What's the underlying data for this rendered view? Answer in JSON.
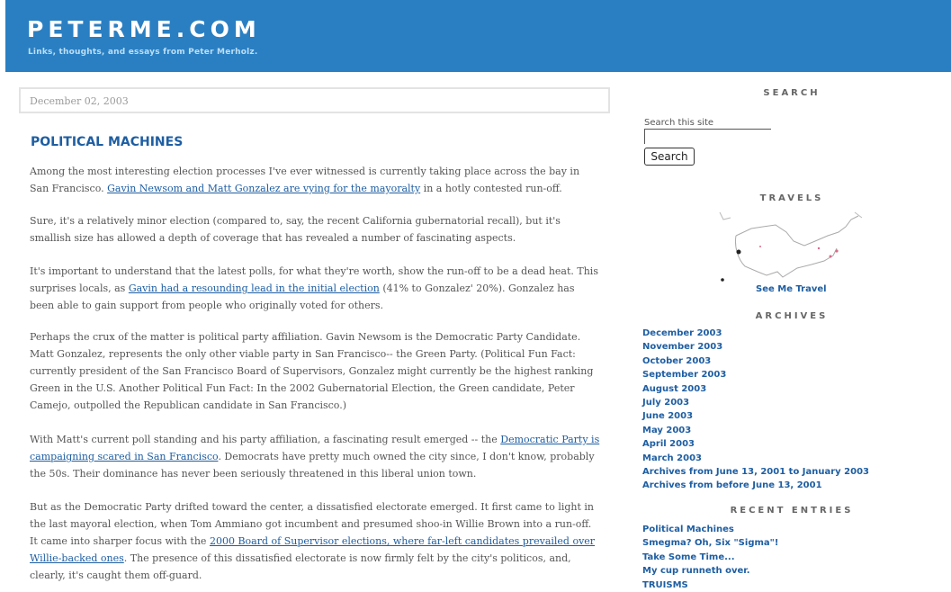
{
  "header": {
    "title": "PETERME.COM",
    "tagline": "Links, thoughts, and essays from Peter Merholz."
  },
  "post": {
    "date": "December 02, 2003",
    "title": "POLITICAL MACHINES",
    "p1": {
      "a": "Among the most interesting election processes I've ever witnessed is currently taking place across the bay in San Francisco.",
      "link": "Gavin Newsom and Matt Gonzalez are vying for the mayoralty",
      "b": " in a hotly contested run-off."
    },
    "p2": "Sure, it's a relatively minor election (compared to, say, the recent California gubernatorial recall), but it's smallish size has allowed a depth of coverage that has revealed a number of fascinating aspects.",
    "p3": {
      "a": "It's important to understand that the latest polls, for what they're worth, show the run-off to be a dead heat. This surprises locals, as ",
      "link": "Gavin had a resounding lead in the initial election",
      "b": " (41% to Gonzalez' 20%). Gonzalez has been able to gain support from people who originally voted for others."
    },
    "p4": "Perhaps the crux of the matter is political party affiliation. Gavin Newsom is the Democratic Party Candidate. Matt Gonzalez, represents the only other viable party in San Francisco-- the Green Party. (Political Fun Fact: currently president of the San Francisco Board of Supervisors, Gonzalez might currently be the highest ranking Green in the U.S. Another Political Fun Fact: In the 2002 Gubernatorial Election, the Green candidate, Peter Camejo, outpolled the Republican candidate in San Francisco.)",
    "p5": {
      "a": "With Matt's current poll standing and his party affiliation, a fascinating result emerged -- the ",
      "link": "Democratic Party is campaigning scared in San Francisco",
      "b": ". Democrats have pretty much owned the city since, I don't know, probably the 50s. Their dominance has never been seriously threatened in this liberal union town."
    },
    "p6": {
      "a": "But as the Democratic Party drifted toward the center, a dissatisfied electorate emerged. It first came to light in the last mayoral election, when Tom Ammiano got incumbent and presumed shoo-in Willie Brown into a run-off. It came into sharper focus with the ",
      "link": "2000 Board of Supervisor elections, where far-left candidates prevailed over Willie-backed ones",
      "b": ". The presence of this dissatisfied electorate is now firmly felt by the city's politicos, and, clearly, it's caught them off-guard."
    }
  },
  "sidebar": {
    "search_heading": "SEARCH",
    "search_label": "Search this site",
    "search_value": "",
    "search_button": "Search",
    "travels_heading": "TRAVELS",
    "see_me_travel": "See Me Travel",
    "archives_heading": "ARCHIVES",
    "archives": [
      "December 2003",
      "November 2003",
      "October 2003",
      "September 2003",
      "August 2003",
      "July 2003",
      "June 2003",
      "May 2003",
      "April 2003",
      "March 2003",
      "Archives from June 13, 2001 to January 2003",
      "Archives from before June 13, 2001"
    ],
    "recent_heading": "RECENT ENTRIES",
    "recent": [
      "Political Machines",
      "Smegma? Oh, Six \"Sigma\"!",
      "Take Some Time...",
      "My cup runneth over.",
      "TRUISMS"
    ]
  },
  "colors": {
    "banner": "#2a7fc2",
    "link": "#1e5ea2"
  }
}
